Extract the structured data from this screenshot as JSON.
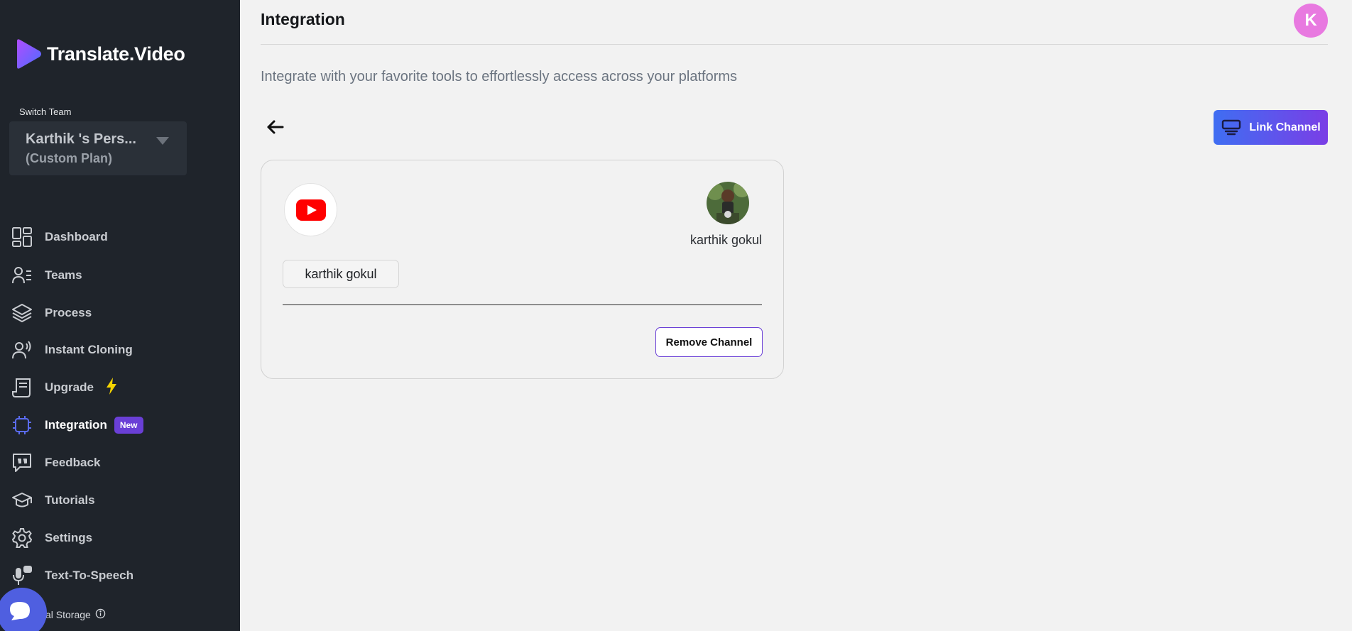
{
  "brand": {
    "name": "Translate.Video"
  },
  "team": {
    "switch_label": "Switch Team",
    "name": "Karthik 's Pers...",
    "plan": "(Custom Plan)"
  },
  "nav": [
    {
      "label": "Dashboard",
      "icon": "dashboard-icon"
    },
    {
      "label": "Teams",
      "icon": "teams-icon"
    },
    {
      "label": "Process",
      "icon": "layers-icon"
    },
    {
      "label": "Instant Cloning",
      "icon": "voice-clone-icon"
    },
    {
      "label": "Upgrade",
      "icon": "receipt-icon"
    },
    {
      "label": "Integration",
      "icon": "chip-icon",
      "badge": "New",
      "active": true
    },
    {
      "label": "Feedback",
      "icon": "quote-icon"
    },
    {
      "label": "Tutorials",
      "icon": "graduation-cap-icon"
    },
    {
      "label": "Settings",
      "icon": "gear-icon"
    },
    {
      "label": "Text-To-Speech",
      "icon": "microphone-icon"
    }
  ],
  "storage": {
    "label": "al Storage"
  },
  "header": {
    "title": "Integration",
    "avatar_initial": "K"
  },
  "page": {
    "subtitle": "Integrate with your favorite tools to effortlessly access across your platforms",
    "link_channel_label": "Link Channel"
  },
  "channel_card": {
    "platform_icon": "youtube-icon",
    "owner_name": "karthik gokul",
    "channel_chip": "karthik gokul",
    "remove_label": "Remove Channel"
  },
  "colors": {
    "sidebar_bg": "#1f242b",
    "accent_purple": "#6a3fd6",
    "accent_blue": "#3f6ef2",
    "avatar_pink": "#e879e0",
    "youtube_red": "#ff0000",
    "bolt_yellow": "#f5d400"
  }
}
